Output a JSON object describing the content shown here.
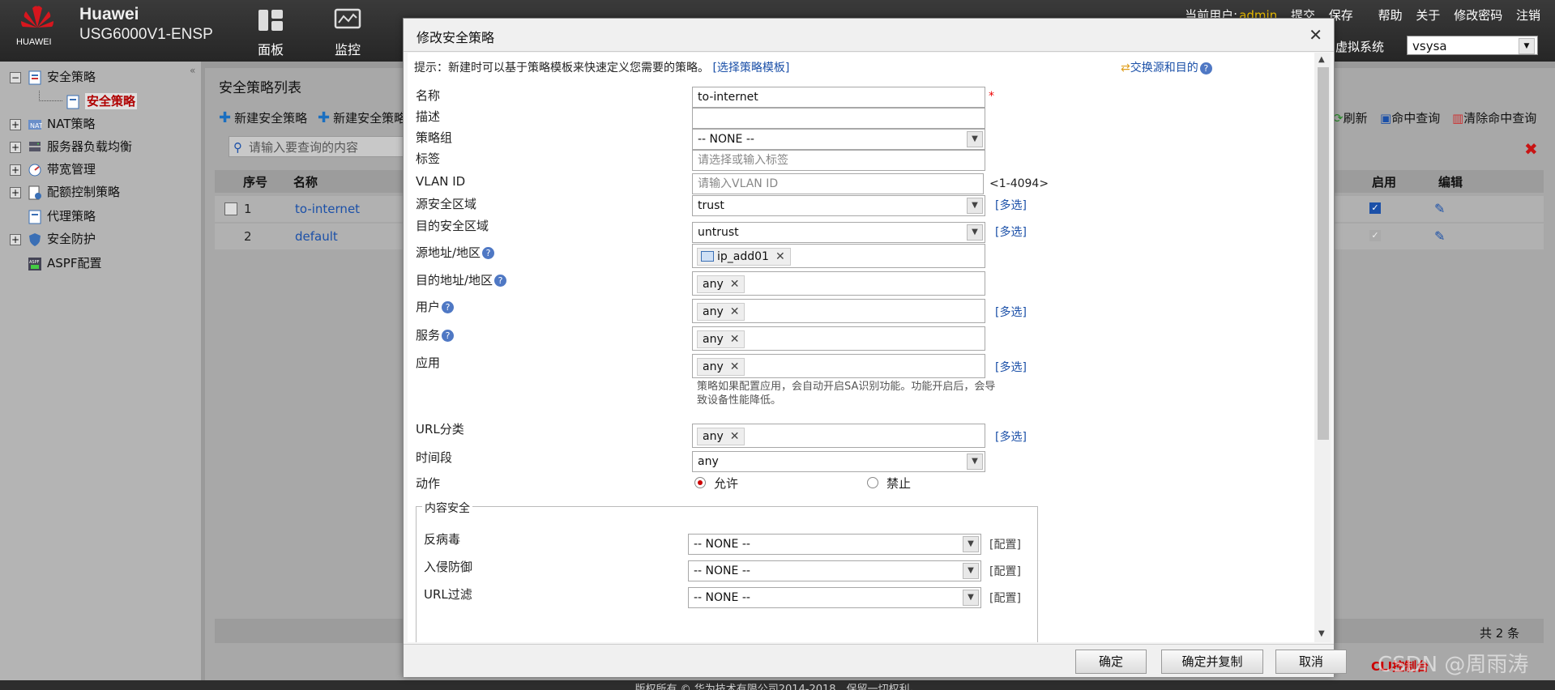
{
  "header": {
    "logo_text": "HUAWEI",
    "brand": "Huawei",
    "model": "USG6000V1-ENSP",
    "nav": [
      {
        "label": "面板",
        "icon": "dashboard-icon"
      },
      {
        "label": "监控",
        "icon": "monitor-icon"
      }
    ],
    "current_user_label": "当前用户:",
    "current_user": "admin",
    "links": [
      "提交",
      "保存",
      "帮助",
      "关于",
      "修改密码",
      "注销"
    ],
    "vsys_label": "虚拟系统",
    "vsys_value": "vsysa"
  },
  "sidebar": {
    "items": [
      {
        "label": "安全策略",
        "expand": "−"
      },
      {
        "label": "安全策略",
        "selected": true
      },
      {
        "label": "NAT策略",
        "expand": "+"
      },
      {
        "label": "服务器负载均衡",
        "expand": "+"
      },
      {
        "label": "带宽管理",
        "expand": "+"
      },
      {
        "label": "配额控制策略",
        "expand": "+"
      },
      {
        "label": "代理策略",
        "expand": ""
      },
      {
        "label": "安全防护",
        "expand": "+"
      },
      {
        "label": "ASPF配置",
        "expand": ""
      }
    ]
  },
  "list": {
    "title": "安全策略列表",
    "toolbar": [
      "新建安全策略",
      "新建安全策略"
    ],
    "right_toolbar": [
      "刷新",
      "命中查询",
      "清除命中查询"
    ],
    "search_placeholder": "请输入要查询的内容",
    "columns": [
      "序号",
      "名称",
      "启用",
      "编辑"
    ],
    "rows": [
      {
        "no": "1",
        "name": "to-internet"
      },
      {
        "no": "2",
        "name": "default"
      }
    ],
    "total": "共 2 条"
  },
  "dialog": {
    "title": "修改安全策略",
    "tip": "提示：新建时可以基于策略模板来快速定义您需要的策略。",
    "tip_link": "[选择策略模板]",
    "swap_link": "交换源和目的",
    "fields": {
      "name_label": "名称",
      "name_value": "to-internet",
      "desc_label": "描述",
      "group_label": "策略组",
      "group_value": "-- NONE --",
      "tag_label": "标签",
      "tag_placeholder": "请选择或输入标签",
      "vlan_label": "VLAN ID",
      "vlan_placeholder": "请输入VLAN ID",
      "vlan_range": "<1-4094>",
      "src_zone_label": "源安全区域",
      "src_zone_value": "trust",
      "dst_zone_label": "目的安全区域",
      "dst_zone_value": "untrust",
      "src_addr_label": "源地址/地区",
      "src_addr_tag": "ip_add01",
      "dst_addr_label": "目的地址/地区",
      "dst_addr_tag": "any",
      "user_label": "用户",
      "user_tag": "any",
      "service_label": "服务",
      "service_tag": "any",
      "app_label": "应用",
      "app_tag": "any",
      "app_note": "策略如果配置应用，会自动开启SA识别功能。功能开启后，会导致设备性能降低。",
      "url_label": "URL分类",
      "url_tag": "any",
      "time_label": "时间段",
      "time_value": "any",
      "action_label": "动作",
      "action_permit": "允许",
      "action_deny": "禁止"
    },
    "multi_select": "[多选]",
    "content_security": {
      "legend": "内容安全",
      "antivirus_label": "反病毒",
      "antivirus_value": "-- NONE --",
      "ips_label": "入侵防御",
      "ips_value": "-- NONE --",
      "url_filter_label": "URL过滤",
      "url_filter_value": "-- NONE --",
      "config_link": "[配置]"
    },
    "buttons": {
      "ok": "确定",
      "ok_copy": "确定并复制",
      "cancel": "取消"
    }
  },
  "footer": {
    "copyright": "版权所有 © 华为技术有限公司2014-2018，保留一切权利。",
    "cli": "CLI控制台",
    "watermark": "CSDN @周雨涛"
  }
}
